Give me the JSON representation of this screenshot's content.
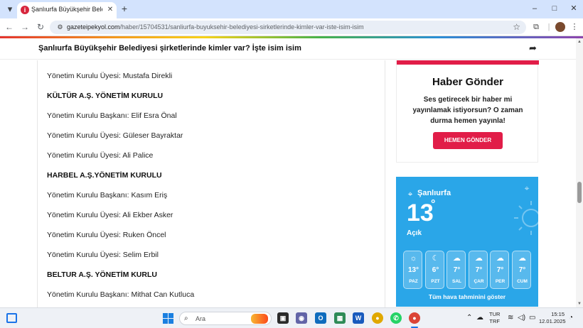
{
  "browser": {
    "tab_title": "Şanlıurfa Büyükşehir Belediyesi",
    "tab_favicon_letter": "i",
    "url_host": "gazeteipekyol.com",
    "url_path": "/haber/15704531/sanliurfa-buyuksehir-belediyesi-sirketlerinde-kimler-var-iste-isim-isim"
  },
  "page": {
    "sticky_title": "Şanlıurfa Büyükşehir Belediyesi şirketlerinde kimler var? İşte isim isim",
    "article_lines": [
      {
        "text": "Yönetim Kurulu Üyesi: Mustafa Direkli",
        "bold": false
      },
      {
        "text": "KÜLTÜR A.Ş. YÖNETİM KURULU",
        "bold": true
      },
      {
        "text": "Yönetim Kurulu Başkanı: Elif Esra Önal",
        "bold": false
      },
      {
        "text": "Yönetim Kurulu Üyesi: Güleser Bayraktar",
        "bold": false
      },
      {
        "text": "Yönetim Kurulu Üyesi: Ali Palice",
        "bold": false
      },
      {
        "text": "HARBEL A.Ş.YÖNETİM KURULU",
        "bold": true
      },
      {
        "text": "Yönetim Kurulu Başkanı: Kasım Eriş",
        "bold": false
      },
      {
        "text": "Yönetim Kurulu Üyesi: Ali Ekber Asker",
        "bold": false
      },
      {
        "text": "Yönetim Kurulu Üyesi: Ruken Öncel",
        "bold": false
      },
      {
        "text": "Yönetim Kurulu Üyesi: Selim Erbil",
        "bold": false
      },
      {
        "text": "BELTUR A.Ş. YÖNETİM KURLU",
        "bold": true
      },
      {
        "text": "Yönetim Kurulu Başkanı: Mithat Can Kutluca",
        "bold": false
      }
    ]
  },
  "sidebar": {
    "haber": {
      "title": "Haber Gönder",
      "text": "Ses getirecek bir haber mi yayınlamak istiyorsun? O zaman durma hemen yayınla!",
      "button": "HEMEN GÖNDER"
    },
    "weather": {
      "city": "Şanlıurfa",
      "temp": "13",
      "degree": "°",
      "condition": "Açık",
      "days": [
        {
          "name": "PAZ",
          "temp": "13°",
          "icon": "sun-icon"
        },
        {
          "name": "PZT",
          "temp": "6°",
          "icon": "moon-icon"
        },
        {
          "name": "SAL",
          "temp": "7°",
          "icon": "cloud-icon"
        },
        {
          "name": "ÇAR",
          "temp": "7°",
          "icon": "cloud-icon"
        },
        {
          "name": "PER",
          "temp": "7°",
          "icon": "cloud-icon"
        },
        {
          "name": "CUM",
          "temp": "7°",
          "icon": "cloud-icon"
        }
      ],
      "link": "Tüm hava tahminini göster"
    }
  },
  "taskbar": {
    "search_placeholder": "Ara",
    "lang_top": "TUR",
    "lang_bottom": "TRF",
    "time": "15:15",
    "date": "12.01.2025"
  },
  "colors": {
    "accent_red": "#e11d48",
    "weather_blue": "#2aa6e8",
    "tabstrip": "#d3e3fd"
  }
}
